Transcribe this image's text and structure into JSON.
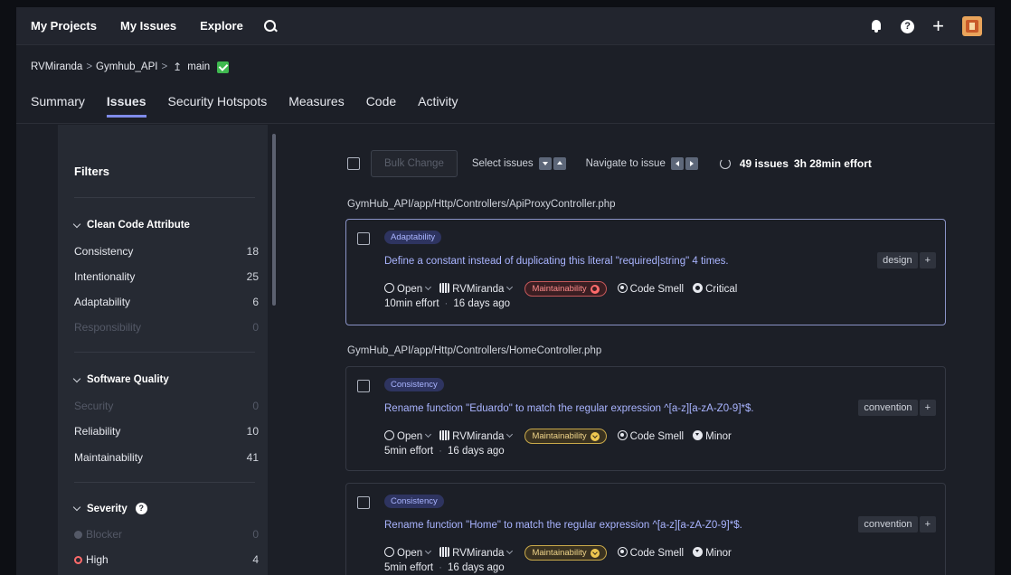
{
  "topnav": {
    "links": [
      "My Projects",
      "My Issues",
      "Explore"
    ]
  },
  "breadcrumb": {
    "org": "RVMiranda",
    "project": "Gymhub_API",
    "branch": "main"
  },
  "tabs": [
    "Summary",
    "Issues",
    "Security Hotspots",
    "Measures",
    "Code",
    "Activity"
  ],
  "sidebar": {
    "title": "Filters",
    "clean_code": {
      "label": "Clean Code Attribute",
      "items": [
        {
          "label": "Consistency",
          "count": "18"
        },
        {
          "label": "Intentionality",
          "count": "25"
        },
        {
          "label": "Adaptability",
          "count": "6"
        },
        {
          "label": "Responsibility",
          "count": "0"
        }
      ]
    },
    "software_quality": {
      "label": "Software Quality",
      "items": [
        {
          "label": "Security",
          "count": "0"
        },
        {
          "label": "Reliability",
          "count": "10"
        },
        {
          "label": "Maintainability",
          "count": "41"
        }
      ]
    },
    "severity": {
      "label": "Severity",
      "items": [
        {
          "label": "Blocker",
          "count": "0"
        },
        {
          "label": "High",
          "count": "4"
        }
      ]
    }
  },
  "toolbar": {
    "bulk_change": "Bulk Change",
    "select_issues": "Select issues",
    "navigate": "Navigate to issue",
    "count": "49 issues",
    "effort": "3h 28min effort"
  },
  "issues": [
    {
      "file": "GymHub_API/app/Http/Controllers/ApiProxyController.php",
      "attribute": "Adaptability",
      "message": "Define a constant instead of duplicating this literal \"required|string\" 4 times.",
      "tag": "design",
      "status": "Open",
      "assignee": "RVMiranda",
      "impact": "Maintainability",
      "type": "Code Smell",
      "severity": "Critical",
      "effort": "10min effort",
      "age": "16 days ago"
    },
    {
      "file": "GymHub_API/app/Http/Controllers/HomeController.php",
      "attribute": "Consistency",
      "message": "Rename function \"Eduardo\" to match the regular expression ^[a-z][a-zA-Z0-9]*$.",
      "tag": "convention",
      "status": "Open",
      "assignee": "RVMiranda",
      "impact": "Maintainability",
      "type": "Code Smell",
      "severity": "Minor",
      "effort": "5min effort",
      "age": "16 days ago"
    },
    {
      "file": "",
      "attribute": "Consistency",
      "message": "Rename function \"Home\" to match the regular expression ^[a-z][a-zA-Z0-9]*$.",
      "tag": "convention",
      "status": "Open",
      "assignee": "RVMiranda",
      "impact": "Maintainability",
      "type": "Code Smell",
      "severity": "Minor",
      "effort": "5min effort",
      "age": "16 days ago"
    }
  ],
  "plus_sign": "+",
  "bc_sep": ">",
  "dot_sep": "·",
  "help_glyph": "?",
  "colors": {
    "accent": "#7f8bea",
    "high_impact": "#ff6b6b",
    "medium_impact": "#f0c850"
  }
}
